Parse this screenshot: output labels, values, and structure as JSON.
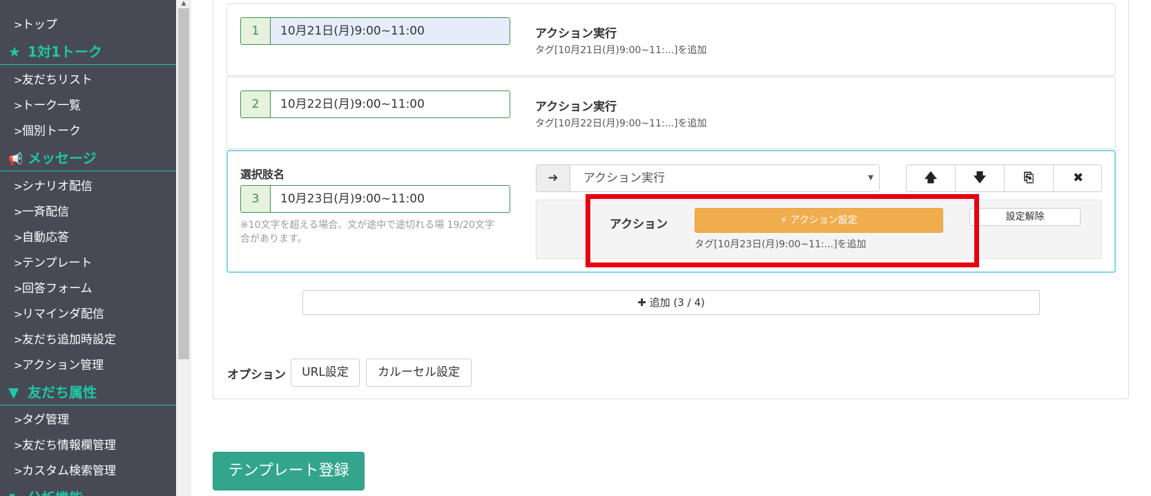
{
  "sidebar": {
    "items": [
      {
        "label": "トップ",
        "type": "item"
      },
      {
        "label": "1対1トーク",
        "type": "section",
        "icon": "star-icon",
        "glyph": "★"
      },
      {
        "label": "友だちリスト",
        "type": "item"
      },
      {
        "label": "トーク一覧",
        "type": "item"
      },
      {
        "label": "個別トーク",
        "type": "item"
      },
      {
        "label": "メッセージ",
        "type": "section",
        "icon": "megaphone-icon",
        "glyph": "📢"
      },
      {
        "label": "シナリオ配信",
        "type": "item"
      },
      {
        "label": "一斉配信",
        "type": "item"
      },
      {
        "label": "自動応答",
        "type": "item"
      },
      {
        "label": "テンプレート",
        "type": "item"
      },
      {
        "label": "回答フォーム",
        "type": "item"
      },
      {
        "label": "リマインダ配信",
        "type": "item"
      },
      {
        "label": "友だち追加時設定",
        "type": "item"
      },
      {
        "label": "アクション管理",
        "type": "item"
      },
      {
        "label": "友だち属性",
        "type": "section",
        "icon": "filter-icon",
        "glyph": "▼"
      },
      {
        "label": "タグ管理",
        "type": "item"
      },
      {
        "label": "友だち情報欄管理",
        "type": "item"
      },
      {
        "label": "カスタム検索管理",
        "type": "item"
      },
      {
        "label": "分析機能",
        "type": "section",
        "icon": "chart-icon",
        "glyph": "▮"
      }
    ],
    "chevron": ">"
  },
  "choices": [
    {
      "num": "1",
      "value": "10月21日(月)9:00~11:00",
      "action_title": "アクション実行",
      "action_desc": "タグ[10月21日(月)9:00~11:...]を追加"
    },
    {
      "num": "2",
      "value": "10月22日(月)9:00~11:00",
      "action_title": "アクション実行",
      "action_desc": "タグ[10月22日(月)9:00~11:...]を追加"
    }
  ],
  "active_choice": {
    "label": "選択肢名",
    "num": "3",
    "value": "10月23日(月)9:00~11:00",
    "hint": "※10文字を超える場合、文が途中で途切れる場",
    "hint2": "合があります。",
    "counter": "19/20文字",
    "action_select": "アクション実行",
    "arrow_glyph": "➜",
    "caret": "▼",
    "buttons": [
      {
        "name": "move-up-button",
        "glyph": "🡅"
      },
      {
        "name": "move-down-button",
        "glyph": "🡇"
      },
      {
        "name": "copy-button",
        "glyph": "⎘"
      },
      {
        "name": "delete-button",
        "glyph": "✖"
      }
    ],
    "action_label": "アクション",
    "action_button": "⚡ アクション設定",
    "action_desc": "タグ[10月23日(月)9:00~11:...]を追加",
    "clear_button": "設定解除"
  },
  "add_button": "✚ 追加 (3 / 4)",
  "options": {
    "label": "オプション",
    "url_button": "URL設定",
    "carousel_button": "カルーセル設定"
  },
  "submit_button": "テンプレート登録",
  "colors": {
    "sidebar_bg": "#474a55",
    "accent_teal": "#1ec8a5",
    "submit_green": "#33a58d",
    "orange": "#f0ad4e",
    "highlight_red": "#e60012"
  }
}
